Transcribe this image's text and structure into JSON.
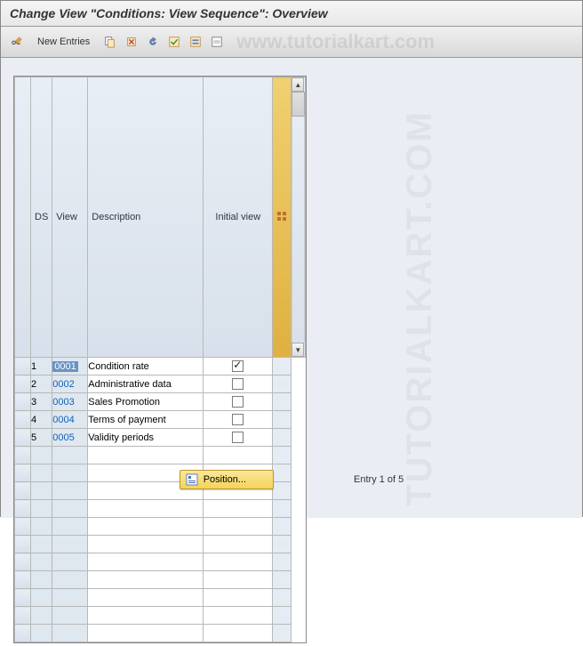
{
  "header": {
    "title": "Change View \"Conditions: View Sequence\": Overview"
  },
  "toolbar": {
    "new_entries_label": "New Entries"
  },
  "watermark": "www.tutorialkart.com",
  "watermark_side": "TUTORIALKART.COM",
  "table": {
    "headers": {
      "ds": "DS",
      "view": "View",
      "description": "Description",
      "initial_view": "Initial view"
    },
    "rows": [
      {
        "ds": "1",
        "view": "0001",
        "description": "Condition rate",
        "initial": true,
        "selected": true
      },
      {
        "ds": "2",
        "view": "0002",
        "description": "Administrative data",
        "initial": false,
        "selected": false
      },
      {
        "ds": "3",
        "view": "0003",
        "description": "Sales Promotion",
        "initial": false,
        "selected": false
      },
      {
        "ds": "4",
        "view": "0004",
        "description": "Terms of payment",
        "initial": false,
        "selected": false
      },
      {
        "ds": "5",
        "view": "0005",
        "description": "Validity periods",
        "initial": false,
        "selected": false
      }
    ],
    "empty_rows": 11
  },
  "footer": {
    "position_label": "Position...",
    "entry_text": "Entry 1 of 5"
  }
}
